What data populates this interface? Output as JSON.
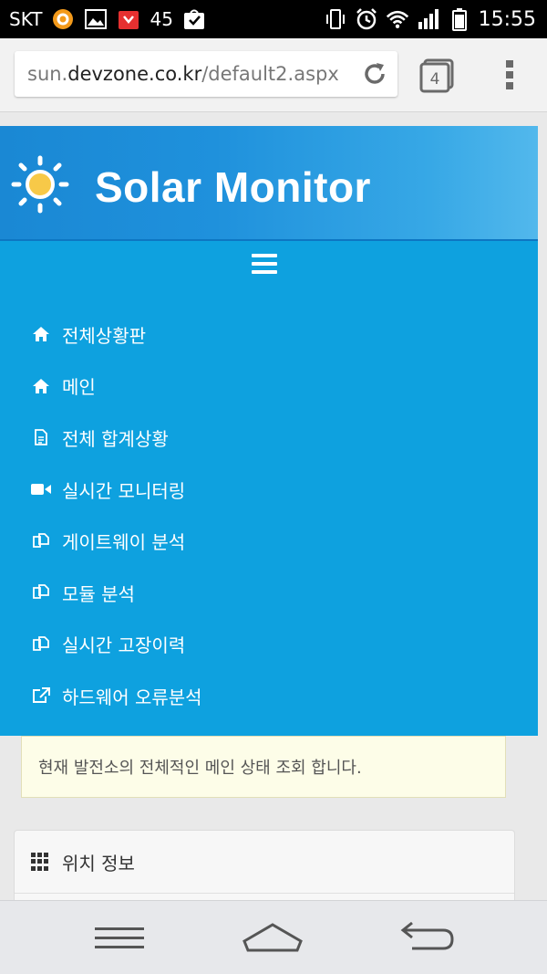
{
  "status_bar": {
    "carrier": "SKT",
    "notification_count": "45",
    "time": "15:55",
    "icons": [
      "app-circle-icon",
      "gallery-icon",
      "gift-icon",
      "check-bag-icon",
      "vibrate-icon",
      "alarm-icon",
      "wifi-icon",
      "signal-icon",
      "battery-icon"
    ]
  },
  "browser": {
    "url_prefix": "sun.",
    "url_domain": "devzone.co.kr",
    "url_path": "/default2.aspx",
    "tab_count": "4"
  },
  "site": {
    "title": "Solar Monitor",
    "brand_color": "#0ea1df"
  },
  "nav": {
    "items": [
      {
        "label": "전체상황판",
        "icon": "home-icon"
      },
      {
        "label": "메인",
        "icon": "home-icon"
      },
      {
        "label": "전체 합계상황",
        "icon": "document-icon"
      },
      {
        "label": "실시간 모니터링",
        "icon": "video-camera-icon"
      },
      {
        "label": "게이트웨이 분석",
        "icon": "copy-icon"
      },
      {
        "label": "모듈 분석",
        "icon": "copy-icon"
      },
      {
        "label": "실시간 고장이력",
        "icon": "copy-icon"
      },
      {
        "label": "하드웨어 오류분석",
        "icon": "external-link-icon"
      }
    ]
  },
  "notice": {
    "text": "현재 발전소의 전체적인 메인 상태 조회 합니다."
  },
  "panel": {
    "title": "위치 정보"
  }
}
